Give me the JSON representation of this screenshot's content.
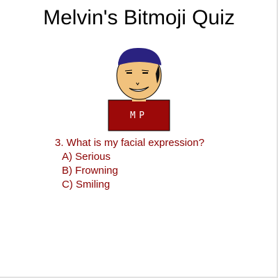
{
  "page": {
    "title": "Melvin's Bitmoji Quiz"
  },
  "avatar": {
    "shirt_text": "MP",
    "colors": {
      "cap": "#2a2280",
      "skin": "#f1c27d",
      "shirt": "#9c0909",
      "shirt_text": "#ffffff",
      "hair": "#111111"
    }
  },
  "quiz": {
    "question": "3. What is my facial expression?",
    "color": "#8b0000",
    "options": [
      {
        "label": "A) Serious"
      },
      {
        "label": "B) Frowning"
      },
      {
        "label": "C) Smiling"
      }
    ]
  }
}
